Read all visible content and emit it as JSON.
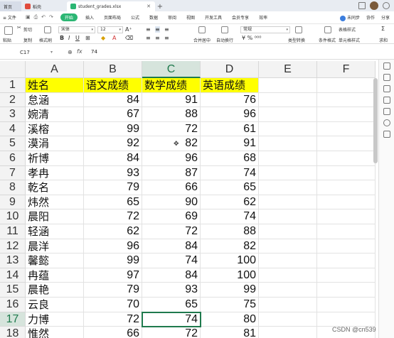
{
  "tabs": {
    "home": "首页",
    "doc1": "稻壳",
    "doc2": "student_grades.xlsx",
    "add": "+"
  },
  "menu": {
    "file": "≡ 文件",
    "items": [
      "开始",
      "插入",
      "页面布局",
      "公式",
      "数据",
      "审阅",
      "视图",
      "开发工具",
      "会员专享",
      "效率"
    ],
    "right": [
      "未同步",
      "协作",
      "分享"
    ]
  },
  "ribbon": {
    "cut": "剪切",
    "copy": "复制",
    "paste": "粘贴",
    "format_painter": "格式刷",
    "font_name": "宋体",
    "font_size": "12",
    "merge": "合并居中",
    "wrap": "自动换行",
    "number_format": "常规",
    "type_convert": "类型转换",
    "conditional": "条件格式",
    "table_style": "表格样式",
    "cell_style": "单元格样式",
    "sum": "求和"
  },
  "formula_bar": {
    "name_box": "C17",
    "fx": "fx",
    "value": "74"
  },
  "colors": {
    "accent": "#1f7a4d",
    "header_fill": "#ffff00",
    "start_button": "#2bb673"
  },
  "sheet": {
    "columns": [
      "A",
      "B",
      "C",
      "D",
      "E",
      "F"
    ],
    "selected_column": "C",
    "selected_row": "17",
    "rows": [
      {
        "n": "1",
        "cells": [
          "姓名",
          "语文成绩",
          "数学成绩",
          "英语成绩"
        ]
      },
      {
        "n": "2",
        "cells": [
          "怠涵",
          "84",
          "91",
          "76"
        ]
      },
      {
        "n": "3",
        "cells": [
          "婉清",
          "67",
          "88",
          "96"
        ]
      },
      {
        "n": "4",
        "cells": [
          "溪榕",
          "99",
          "72",
          "61"
        ]
      },
      {
        "n": "5",
        "cells": [
          "漠涓",
          "92",
          "82",
          "91"
        ]
      },
      {
        "n": "6",
        "cells": [
          "祈博",
          "84",
          "96",
          "68"
        ]
      },
      {
        "n": "7",
        "cells": [
          "孝冉",
          "93",
          "87",
          "74"
        ]
      },
      {
        "n": "8",
        "cells": [
          "乾名",
          "79",
          "66",
          "65"
        ]
      },
      {
        "n": "9",
        "cells": [
          "炜然",
          "65",
          "90",
          "62"
        ]
      },
      {
        "n": "10",
        "cells": [
          "晨阳",
          "72",
          "69",
          "74"
        ]
      },
      {
        "n": "11",
        "cells": [
          "轻涵",
          "62",
          "72",
          "88"
        ]
      },
      {
        "n": "12",
        "cells": [
          "晨洋",
          "96",
          "84",
          "82"
        ]
      },
      {
        "n": "13",
        "cells": [
          "馨懿",
          "99",
          "74",
          "100"
        ]
      },
      {
        "n": "14",
        "cells": [
          "冉蕴",
          "97",
          "84",
          "100"
        ]
      },
      {
        "n": "15",
        "cells": [
          "晨艳",
          "79",
          "93",
          "99"
        ]
      },
      {
        "n": "16",
        "cells": [
          "云良",
          "70",
          "65",
          "75"
        ]
      },
      {
        "n": "17",
        "cells": [
          "力博",
          "72",
          "74",
          "80"
        ]
      },
      {
        "n": "18",
        "cells": [
          "惟然",
          "66",
          "72",
          "81"
        ]
      }
    ]
  },
  "watermark": "CSDN @cn539"
}
